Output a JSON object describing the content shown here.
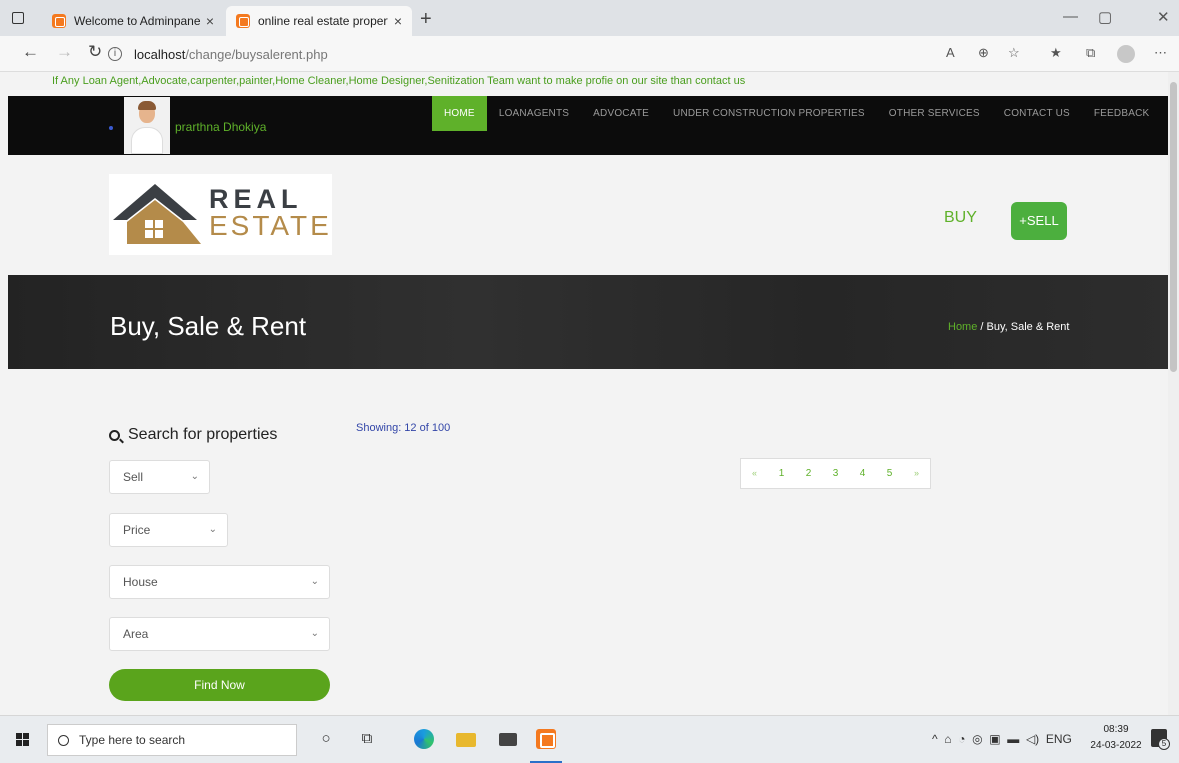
{
  "browser": {
    "tabs": [
      {
        "title": "Welcome to Adminpanel",
        "close": "×"
      },
      {
        "title": "online real estate property mana",
        "close": "×"
      }
    ],
    "new_tab": "+",
    "url_host": "localhost",
    "url_path": "/change/buysalerent.php",
    "win_controls": {
      "minimize": "—",
      "maximize": "▢",
      "close": "✕"
    }
  },
  "site": {
    "notice": "If Any Loan Agent,Advocate,carpenter,painter,Home Cleaner,Home Designer,Senitization Team want to make profie on our site than contact us",
    "user_name": "prarthna Dhokiya",
    "nav": [
      "HOME",
      "LOANAGENTS",
      "ADVOCATE",
      "UNDER CONSTRUCTION PROPERTIES",
      "OTHER SERVICES",
      "CONTACT US",
      "FEEDBACK"
    ],
    "logo": {
      "line1": "REAL",
      "line2": "ESTATE"
    },
    "buy": "BUY",
    "sell": "+SELL",
    "banner": {
      "title": "Buy, Sale & Rent",
      "crumb_home": "Home",
      "crumb_rest": " / Buy, Sale & Rent"
    },
    "search": {
      "heading": "Search for properties",
      "type": "Sell",
      "price": "Price",
      "property": "House",
      "area": "Area",
      "button": "Find Now"
    },
    "showing": "Showing: 12 of 100",
    "pagination": [
      "«",
      "1",
      "2",
      "3",
      "4",
      "5",
      "»"
    ]
  },
  "taskbar": {
    "search_placeholder": "Type here to search",
    "tray_lang": "ENG",
    "time": "08:39",
    "date": "24-03-2022",
    "notifications": "5"
  },
  "colors": {
    "accent_green": "#5fb12a",
    "nav_bg": "#0c0c0c",
    "banner_bg": "#2b2b2b"
  }
}
